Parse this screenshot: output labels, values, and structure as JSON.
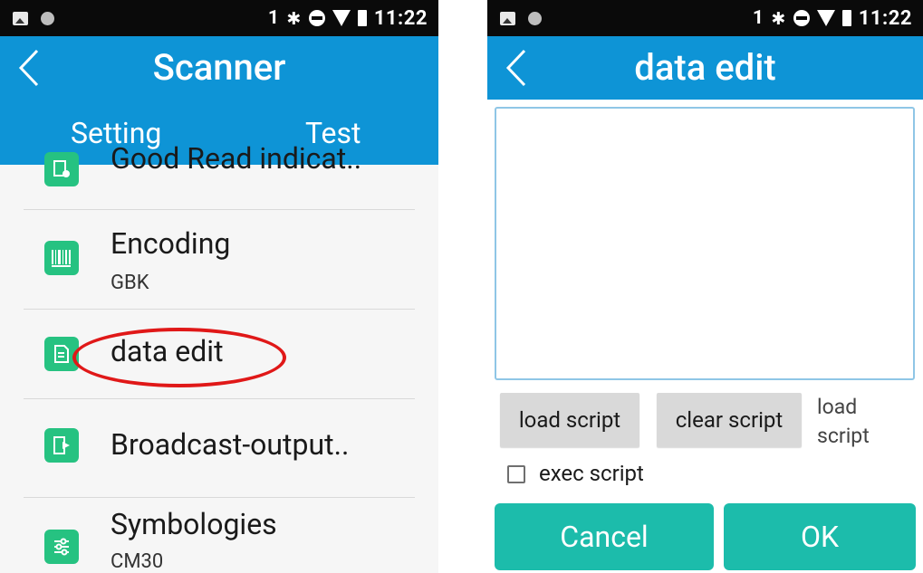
{
  "status_bar": {
    "sim_indicator": "1",
    "time": "11:22",
    "icons": [
      "image-icon",
      "circle-dot-icon",
      "bluetooth-icon",
      "do-not-disturb-icon",
      "wifi-icon",
      "battery-icon"
    ]
  },
  "left_screen": {
    "title": "Scanner",
    "tabs": [
      "Setting",
      "Test"
    ],
    "items": [
      {
        "title": "Good Read indicat..",
        "subtitle": "",
        "icon": "good-read-icon"
      },
      {
        "title": "Encoding",
        "subtitle": "GBK",
        "icon": "barcode-icon"
      },
      {
        "title": "data edit",
        "subtitle": "",
        "icon": "data-edit-icon",
        "highlighted": true
      },
      {
        "title": "Broadcast-output..",
        "subtitle": "",
        "icon": "broadcast-output-icon"
      },
      {
        "title": "Symbologies",
        "subtitle": "CM30",
        "icon": "sliders-icon"
      }
    ]
  },
  "right_screen": {
    "title": "data edit",
    "editor_value": "",
    "load_script_button": "load script",
    "clear_script_button": "clear script",
    "load_script_status": "load script",
    "exec_script_label": "exec script",
    "exec_script_checked": false,
    "cancel_button": "Cancel",
    "ok_button": "OK"
  },
  "colors": {
    "appbar": "#0e94d6",
    "accent_teal": "#1cbcab",
    "icon_green": "#26c281",
    "highlight_red": "#e01818"
  }
}
